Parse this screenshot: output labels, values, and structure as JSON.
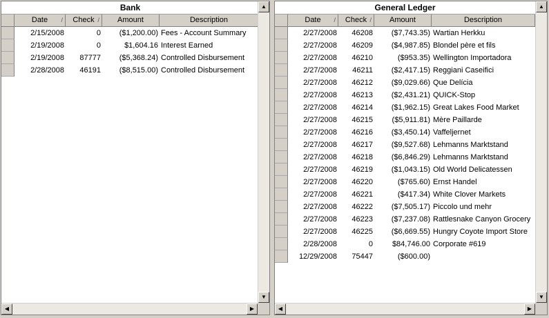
{
  "bank": {
    "title": "Bank",
    "columns": [
      "Date",
      "Check",
      "Amount",
      "Description"
    ],
    "rows": [
      [
        "2/15/2008",
        "0",
        "($1,200.00)",
        "Fees - Account Summary"
      ],
      [
        "2/19/2008",
        "0",
        "$1,604.16",
        "Interest Earned"
      ],
      [
        "2/19/2008",
        "87777",
        "($5,368.24)",
        "Controlled Disbursement"
      ],
      [
        "2/28/2008",
        "46191",
        "($8,515.00)",
        "Controlled Disbursement"
      ]
    ]
  },
  "ledger": {
    "title": "General Ledger",
    "columns": [
      "Date",
      "Check",
      "Amount",
      "Description"
    ],
    "rows": [
      [
        "2/27/2008",
        "46208",
        "($7,743.35)",
        "Wartian Herkku"
      ],
      [
        "2/27/2008",
        "46209",
        "($4,987.85)",
        "Blondel père et fils"
      ],
      [
        "2/27/2008",
        "46210",
        "($953.35)",
        "Wellington Importadora"
      ],
      [
        "2/27/2008",
        "46211",
        "($2,417.15)",
        "Reggiani Caseifici"
      ],
      [
        "2/27/2008",
        "46212",
        "($9,029.66)",
        "Que Delícia"
      ],
      [
        "2/27/2008",
        "46213",
        "($2,431.21)",
        "QUICK-Stop"
      ],
      [
        "2/27/2008",
        "46214",
        "($1,962.15)",
        "Great Lakes Food Market"
      ],
      [
        "2/27/2008",
        "46215",
        "($5,911.81)",
        "Mère Paillarde"
      ],
      [
        "2/27/2008",
        "46216",
        "($3,450.14)",
        "Vaffeljernet"
      ],
      [
        "2/27/2008",
        "46217",
        "($9,527.68)",
        "Lehmanns Marktstand"
      ],
      [
        "2/27/2008",
        "46218",
        "($6,846.29)",
        "Lehmanns Marktstand"
      ],
      [
        "2/27/2008",
        "46219",
        "($1,043.15)",
        "Old World Delicatessen"
      ],
      [
        "2/27/2008",
        "46220",
        "($765.60)",
        "Ernst Handel"
      ],
      [
        "2/27/2008",
        "46221",
        "($417.34)",
        "White Clover Markets"
      ],
      [
        "2/27/2008",
        "46222",
        "($7,505.17)",
        "Piccolo und mehr"
      ],
      [
        "2/27/2008",
        "46223",
        "($7,237.08)",
        "Rattlesnake Canyon Grocery"
      ],
      [
        "2/27/2008",
        "46225",
        "($6,669.55)",
        "Hungry Coyote Import Store"
      ],
      [
        "2/28/2008",
        "0",
        "$84,746.00",
        "Corporate #619"
      ],
      [
        "12/29/2008",
        "75447",
        "($600.00)",
        ""
      ]
    ]
  },
  "icons": {
    "scroll_up": "▲",
    "scroll_down": "▼",
    "scroll_left": "◀",
    "scroll_right": "▶",
    "sort": "/"
  },
  "colors": {
    "window_bg": "#d4d0c8",
    "grid_bg": "#ffffff",
    "header_bg": "#d4d0c8"
  }
}
